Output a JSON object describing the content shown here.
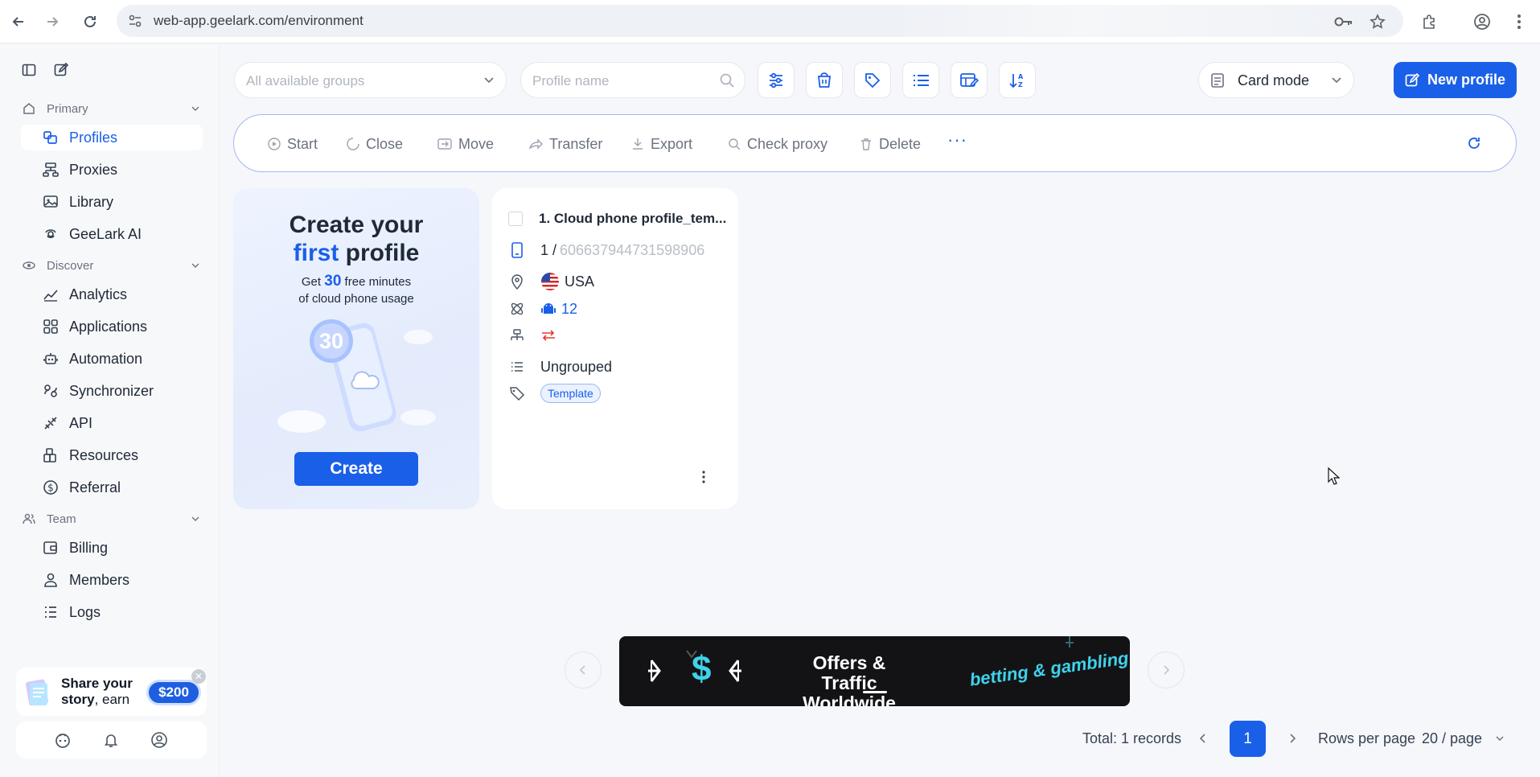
{
  "browser": {
    "url": "web-app.geelark.com/environment"
  },
  "sidebar": {
    "sections": [
      {
        "label": "Primary"
      },
      {
        "label": "Discover"
      },
      {
        "label": "Team"
      }
    ],
    "items": [
      {
        "label": "Profiles",
        "icon": "profiles-icon"
      },
      {
        "label": "Proxies",
        "icon": "proxies-icon"
      },
      {
        "label": "Library",
        "icon": "library-icon"
      },
      {
        "label": "GeeLark AI",
        "icon": "ai-icon"
      },
      {
        "label": "Analytics",
        "icon": "analytics-icon"
      },
      {
        "label": "Applications",
        "icon": "applications-icon"
      },
      {
        "label": "Automation",
        "icon": "automation-icon"
      },
      {
        "label": "Synchronizer",
        "icon": "synchronizer-icon"
      },
      {
        "label": "API",
        "icon": "api-icon"
      },
      {
        "label": "Resources",
        "icon": "resources-icon"
      },
      {
        "label": "Referral",
        "icon": "referral-icon"
      },
      {
        "label": "Billing",
        "icon": "billing-icon"
      },
      {
        "label": "Members",
        "icon": "members-icon"
      },
      {
        "label": "Logs",
        "icon": "logs-icon"
      }
    ],
    "promo": {
      "line1": "Share your",
      "line2_bold": "story",
      "line2_rest": ", earn",
      "badge": "$200"
    }
  },
  "toolbar": {
    "group_placeholder": "All available groups",
    "search_placeholder": "Profile name",
    "mode": "Card mode",
    "new_profile": "New profile"
  },
  "actions": [
    "Start",
    "Close",
    "Move",
    "Transfer",
    "Export",
    "Check proxy",
    "Delete"
  ],
  "create_card": {
    "title_line1": "Create your",
    "title_first": "first",
    "title_profile": " profile",
    "sub_get": "Get ",
    "sub_num": "30",
    "sub_rest": " free minutes",
    "sub_line2": "of cloud phone usage",
    "badge_num": "30",
    "button": "Create"
  },
  "profile_card": {
    "title": "1. Cloud phone profile_tem...",
    "serial_prefix": "1 / ",
    "serial": "606637944731598906",
    "country": "USA",
    "android_version": "12",
    "group": "Ungrouped",
    "tag": "Template"
  },
  "banner": {
    "title_line1": "Offers & Traffic",
    "title_line2": "Worldwide",
    "sub": "betting & gambling",
    "dollar": "$"
  },
  "pagination": {
    "total": "Total: 1 records",
    "current_page": "1",
    "rows_label": "Rows per page",
    "rows_value": "20 / page"
  },
  "colors": {
    "accent": "#1a5fe8",
    "banner_bg": "#131316",
    "banner_accent": "#3fd2ea"
  }
}
